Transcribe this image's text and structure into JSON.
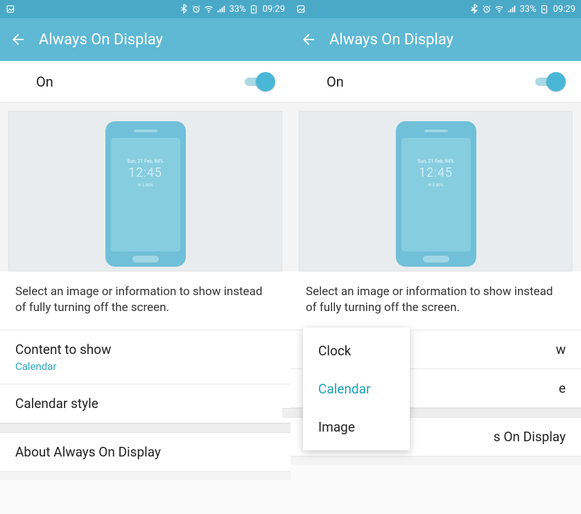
{
  "status": {
    "battery_text": "33%",
    "time": "09:29"
  },
  "app_bar": {
    "title": "Always On Display"
  },
  "toggle": {
    "label": "On",
    "state": true
  },
  "phone_preview": {
    "date_line": "Sun, 21 Feb, 94%",
    "time": "12:45",
    "small_line": "✉ 5   80%"
  },
  "description": "Select an image or information to show instead of fully turning off the screen.",
  "options": {
    "content_to_show": {
      "title": "Content to show",
      "value": "Calendar"
    },
    "calendar_style": {
      "title": "Calendar style"
    },
    "about": {
      "title": "About Always On Display"
    }
  },
  "popup": {
    "items": [
      "Clock",
      "Calendar",
      "Image"
    ],
    "selected_index": 1
  },
  "right_screen_partial": {
    "content_suffix": "w",
    "style_suffix": "e",
    "about_suffix": "s On Display"
  }
}
